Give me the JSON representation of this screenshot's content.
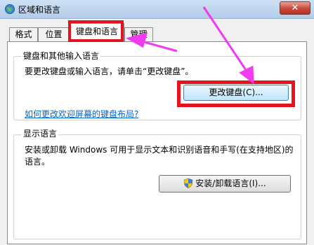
{
  "window": {
    "title": "区域和语言",
    "close_glyph": "✕"
  },
  "tabs": [
    {
      "label": "格式"
    },
    {
      "label": "位置"
    },
    {
      "label": "键盘和语言"
    },
    {
      "label": "管理"
    }
  ],
  "keyboard_group": {
    "legend": "键盘和其他输入语言",
    "description": "要更改键盘或输入语言，请单击“更改键盘”。",
    "change_button": "更改键盘(C)...",
    "link": "如何更改欢迎屏幕的键盘布局?"
  },
  "display_group": {
    "legend": "显示语言",
    "description": "安装或卸载 Windows 可用于显示文本和识别语音和手写(在支持地区)的语言。",
    "install_button": "安装/卸载语言(I)..."
  },
  "colors": {
    "highlight": "#e3141e",
    "arrow": "#f03cf0",
    "link": "#0066cc"
  }
}
